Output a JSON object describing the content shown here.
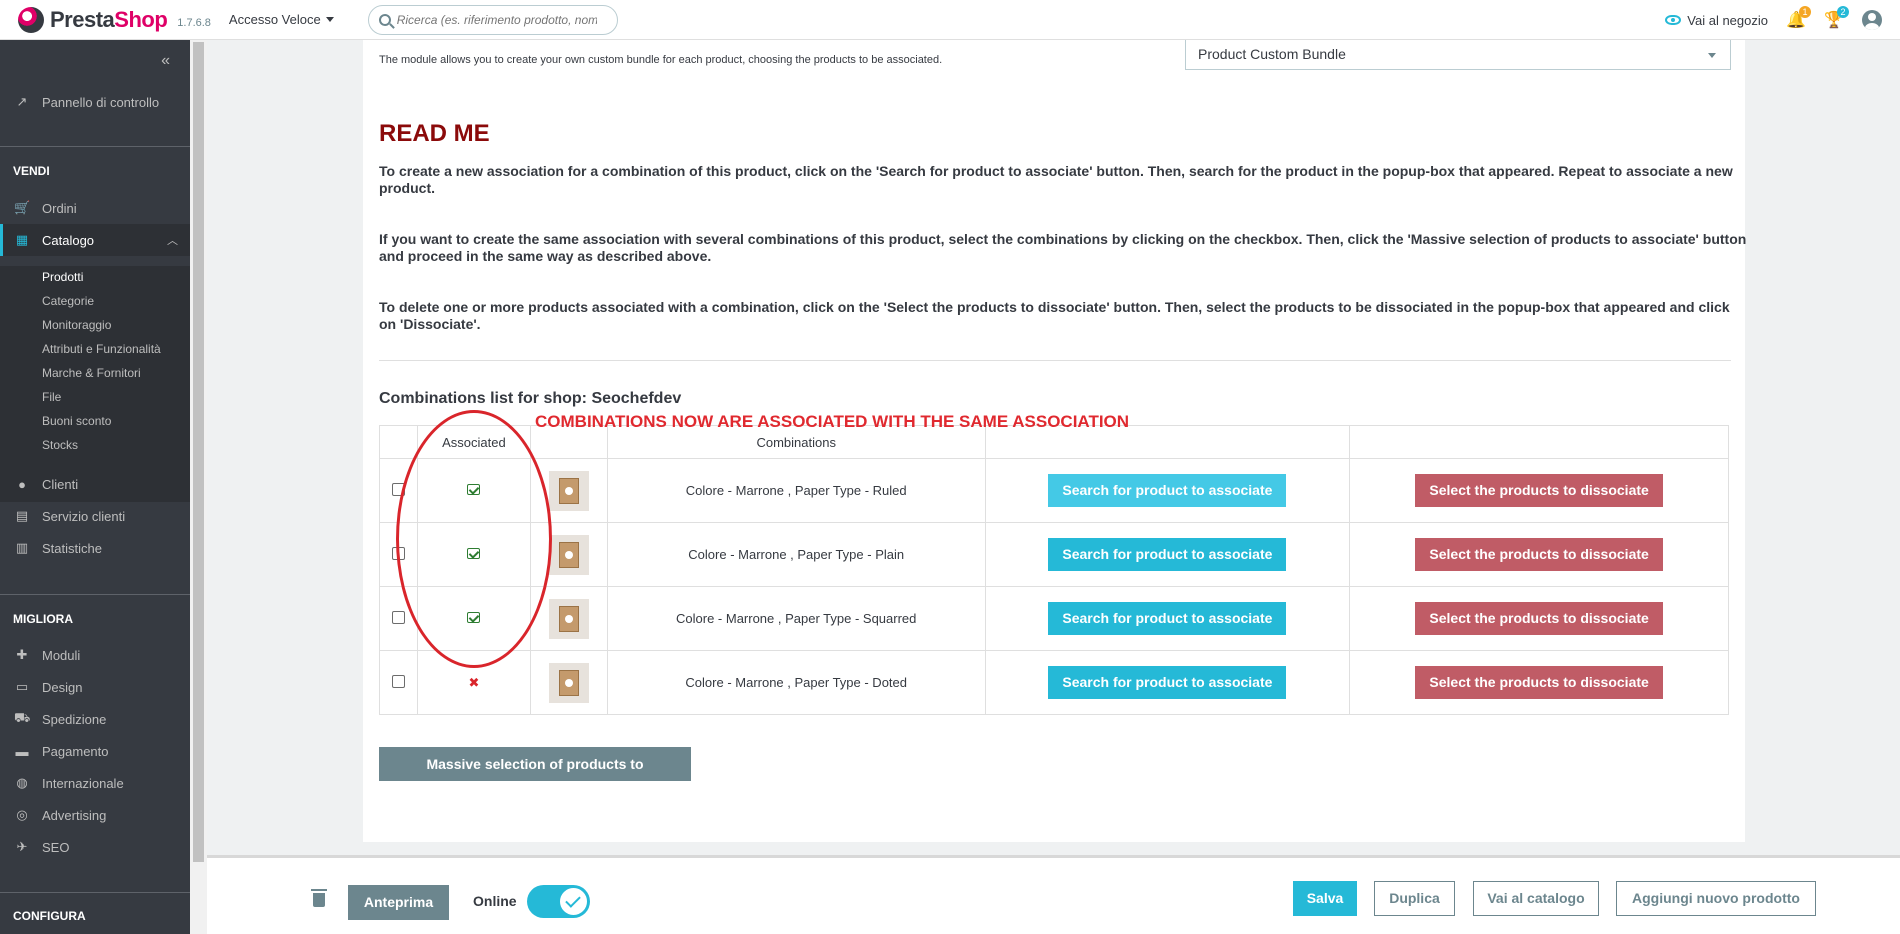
{
  "header": {
    "brand_pre": "Presta",
    "brand_post": "Shop",
    "version": "1.7.6.8",
    "quick_access": "Accesso Veloce",
    "search_placeholder": "Ricerca (es. riferimento prodotto, nome",
    "shop_link": "Vai al negozio",
    "notif_orders": "1",
    "notif_customers": "2",
    "accent": "#25b9d7",
    "brand_color": "#df0067"
  },
  "sidebar": {
    "collapse": "«",
    "dashboard": "Pannello di controllo",
    "sec_sell": "VENDI",
    "orders": "Ordini",
    "catalog": "Catalogo",
    "catalog_sub": [
      "Prodotti",
      "Categorie",
      "Monitoraggio",
      "Attributi e Funzionalità",
      "Marche & Fornitori",
      "File",
      "Buoni sconto",
      "Stocks"
    ],
    "customers": "Clienti",
    "service": "Servizio clienti",
    "stats": "Statistiche",
    "sec_improve": "MIGLIORA",
    "modules": "Moduli",
    "design": "Design",
    "shipping": "Spedizione",
    "payment": "Pagamento",
    "international": "Internazionale",
    "advertising": "Advertising",
    "seo": "SEO",
    "sec_config": "CONFIGURA"
  },
  "module": {
    "description": "The module allows you to create your own custom bundle for each product, choosing the products to be associated.",
    "selected": "Product Custom Bundle"
  },
  "readme": {
    "title": "READ ME",
    "p1": "To create a new association for a combination of this product, click on the 'Search for product to associate' button. Then, search for the product in the popup-box that appeared. Repeat to associate a new product.",
    "p2": "If you want to create the same association with several combinations of this product, select the combinations by clicking on the checkbox. Then, click the 'Massive selection of products to associate' button and proceed in the same way as described above.",
    "p3": "To delete one or more products associated with a combination, click on the 'Select the products to dissociate' button. Then, select the products to be dissociated in the popup-box that appeared and click on 'Dissociate'."
  },
  "combinations": {
    "title": "Combinations list for shop: Seochefdev",
    "annotation": "COMBINATIONS NOW ARE ASSOCIATED WITH THE SAME ASSOCIATION",
    "headers": [
      "",
      "Associated",
      "",
      "Combinations",
      "",
      ""
    ],
    "search_btn": "Search for product to associate",
    "dissociate_btn": "Select the products to dissociate",
    "rows": [
      {
        "name": "Colore - Marrone ,  Paper Type - Ruled",
        "associated": true
      },
      {
        "name": "Colore - Marrone ,  Paper Type - Plain",
        "associated": true
      },
      {
        "name": "Colore - Marrone ,  Paper Type - Squarred",
        "associated": true
      },
      {
        "name": "Colore - Marrone ,  Paper Type - Doted",
        "associated": false
      }
    ],
    "massive_btn": "Massive selection of products to associate"
  },
  "footer": {
    "preview": "Anteprima",
    "online": "Online",
    "save": "Salva",
    "duplicate": "Duplica",
    "catalog": "Vai al catalogo",
    "new_product": "Aggiungi nuovo prodotto"
  }
}
